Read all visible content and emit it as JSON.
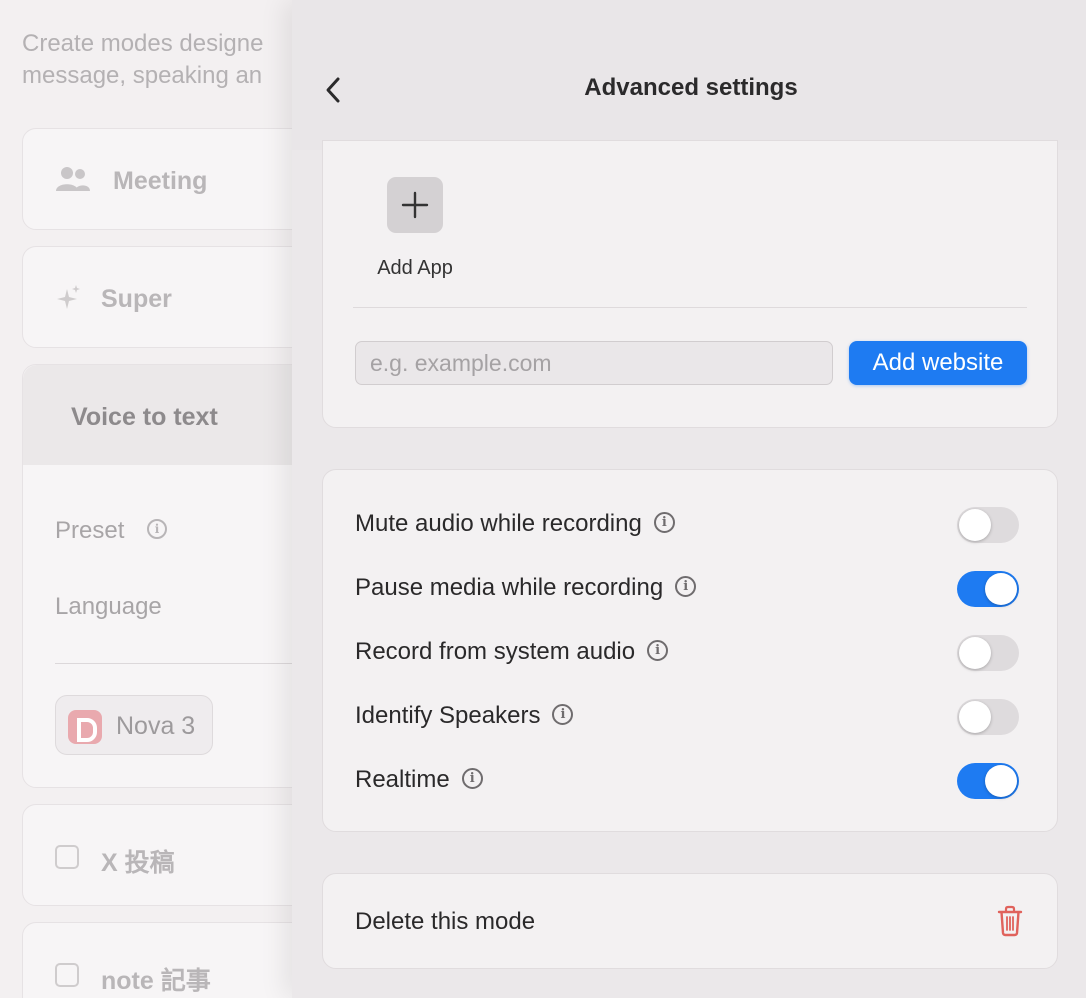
{
  "background": {
    "description_line1": "Create modes designe",
    "description_line2": "message, speaking an",
    "modes": [
      {
        "label": "Meeting",
        "icon": "people-icon"
      },
      {
        "label": "Super",
        "icon": "sparkle-icon"
      }
    ],
    "voice_card": {
      "title": "Voice to text",
      "preset_label": "Preset",
      "language_label": "Language",
      "model_label": "Nova 3"
    },
    "more_modes": [
      {
        "label": "X 投稿"
      },
      {
        "label": "note 記事"
      }
    ]
  },
  "panel": {
    "title": "Advanced settings",
    "back_icon": "chevron-left-icon",
    "apps": {
      "add_app_label": "Add App",
      "website_placeholder": "e.g. example.com",
      "website_value": "",
      "add_website_label": "Add website"
    },
    "settings": [
      {
        "label": "Mute audio while recording",
        "enabled": false
      },
      {
        "label": "Pause media while recording",
        "enabled": true
      },
      {
        "label": "Record from system audio",
        "enabled": false
      },
      {
        "label": "Identify Speakers",
        "enabled": false
      },
      {
        "label": "Realtime",
        "enabled": true
      }
    ],
    "delete_label": "Delete this mode"
  },
  "colors": {
    "accent": "#1e7bf2",
    "danger": "#e0625c"
  }
}
